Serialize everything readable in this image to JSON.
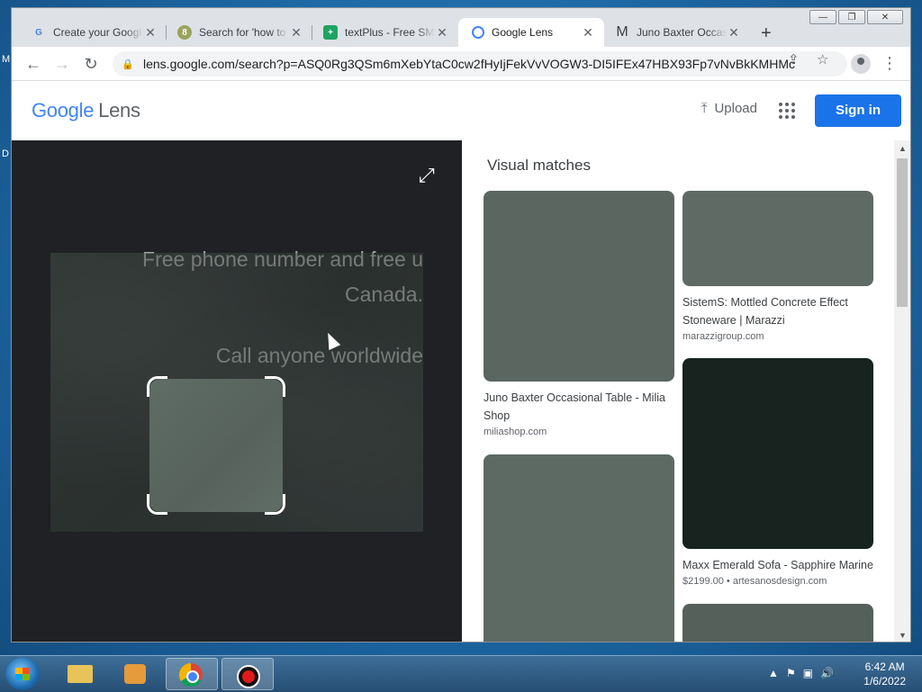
{
  "desktop": {
    "left_labels": [
      "M",
      "D"
    ]
  },
  "window": {
    "controls": {
      "minimize": "—",
      "maximize": "❐",
      "close": "✕"
    }
  },
  "tabs": [
    {
      "title": "Create your Google",
      "favicon": "google-icon",
      "active": false
    },
    {
      "title": "Search for 'how to",
      "favicon": "search-app-icon",
      "active": false
    },
    {
      "title": "textPlus - Free SMS",
      "favicon": "textplus-icon",
      "active": false
    },
    {
      "title": "Google Lens",
      "favicon": "google-lens-icon",
      "active": true
    },
    {
      "title": "Juno Baxter Occasio",
      "favicon": "milia-m-icon",
      "active": false
    }
  ],
  "toolbar": {
    "url": "lens.google.com/search?p=ASQ0Rg3QSm6mXebYtaC0cw2fHyIjFekVvVOGW3-DI5IFEx47HBX93Fp7vNvBkKMHMc..."
  },
  "lens": {
    "logo_google": "Google",
    "logo_lens": "Lens",
    "upload_label": "Upload",
    "signin_label": "Sign in",
    "overlay_text": [
      "Free phone number and free u",
      "Canada.",
      "Call anyone worldwide"
    ],
    "results_title": "Visual matches",
    "results": [
      {
        "title": "Juno Baxter Occasional Table - Milia Shop",
        "source": "miliashop.com",
        "color": "#5b6661"
      },
      {
        "title": "SistemS: Mottled Concrete Effect Stoneware | Marazzi",
        "source": "marazzigroup.com",
        "color": "#5f6a64"
      },
      {
        "title": "Maxx Emerald Sofa - Sapphire Marine",
        "source": "$2199.00 • artesanosdesign.com",
        "color": "#18231f"
      },
      {
        "title": "",
        "source": "",
        "color": "#5d6a64"
      },
      {
        "title": "",
        "source": "",
        "color": "#56605a"
      }
    ]
  },
  "taskbar": {
    "time": "6:42 AM",
    "date": "1/6/2022",
    "tray_icons": [
      "▲",
      "⚑",
      "▣",
      "🔊"
    ]
  },
  "colors": {
    "accent": "#1a73e8",
    "viewer_bg": "#202124"
  }
}
